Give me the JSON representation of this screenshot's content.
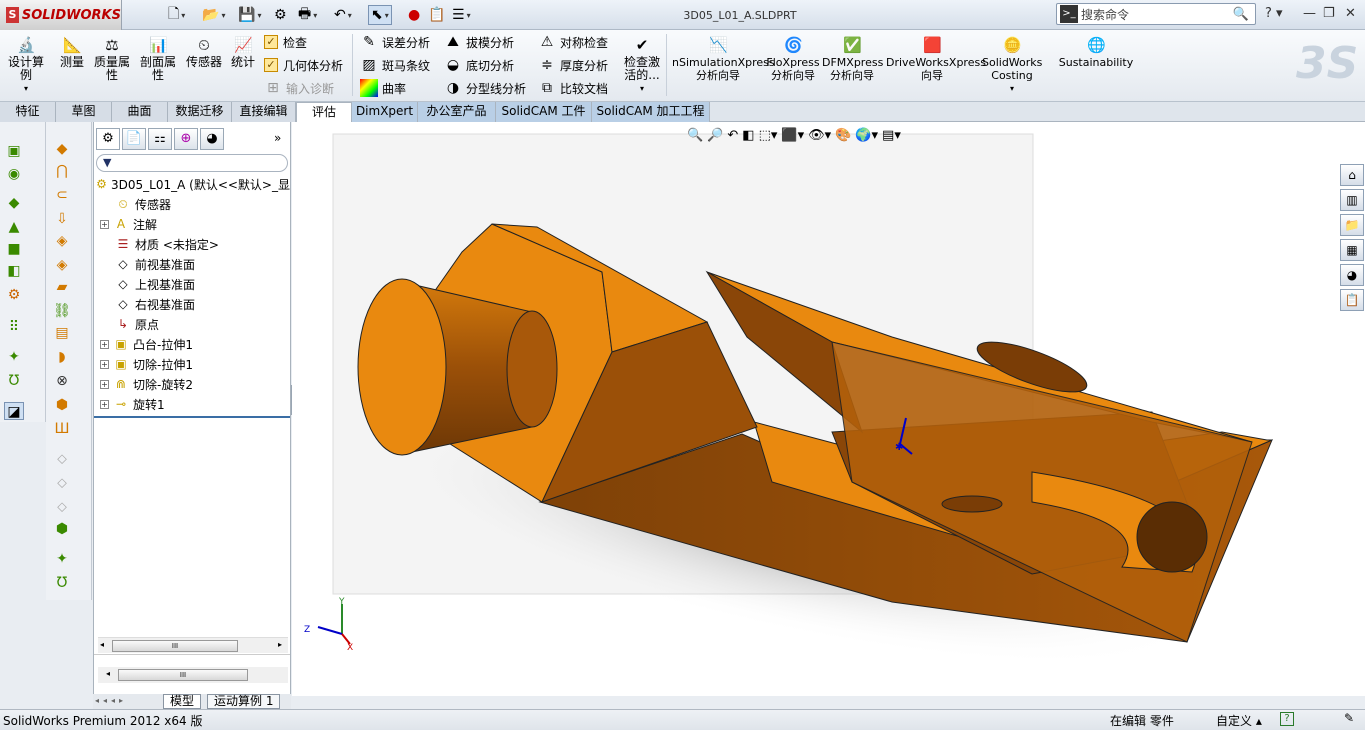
{
  "app": {
    "brand": "SOLIDWORKS",
    "doc_title": "3D05_L01_A.SLDPRT"
  },
  "search": {
    "placeholder": "搜索命令"
  },
  "ribbon": {
    "design_study": "设计算例",
    "measure": "测量",
    "mass_props": "质量属性",
    "section_props": "剖面属性",
    "sensor": "传感器",
    "stats": "统计",
    "check": "检查",
    "geometry_analysis": "几何体分析",
    "import_diag": "输入诊断",
    "deviation": "误差分析",
    "zebra": "斑马条纹",
    "curvature": "曲率",
    "draft": "拔模分析",
    "undercut": "底切分析",
    "parting_line": "分型线分析",
    "symmetry": "对称检查",
    "thickness": "厚度分析",
    "compare": "比较文档",
    "check_active": "检查激活的...",
    "simxpress": "nSimulationXpress\n分析向导",
    "floxpress": "FloXpress\n分析向导",
    "dfmxpress": "DFMXpress\n分析向导",
    "driveworks": "DriveWorksXpress\n向导",
    "costing": "SolidWorks\nCosting",
    "sustainability": "Sustainability"
  },
  "tabs": [
    "特征",
    "草图",
    "曲面",
    "数据迁移",
    "直接编辑",
    "评估",
    "DimXpert",
    "办公室产品",
    "SolidCAM 工件",
    "SolidCAM 加工工程"
  ],
  "active_tab": "评估",
  "tree": {
    "root": "3D05_L01_A  (默认<<默认>_显",
    "items": [
      "传感器",
      "注解",
      "材质 <未指定>",
      "前视基准面",
      "上视基准面",
      "右视基准面",
      "原点",
      "凸台-拉伸1",
      "切除-拉伸1",
      "切除-旋转2",
      "旋转1"
    ]
  },
  "bottom_tabs": [
    "模型",
    "运动算例 1"
  ],
  "status": {
    "left": "SolidWorks Premium 2012 x64 版",
    "editing": "在编辑 零件",
    "custom": "自定义"
  },
  "scrollbar_glyph": "III",
  "triad": {
    "x": "X",
    "y": "Y",
    "z": "Z"
  },
  "colors": {
    "part_light": "#e9890f",
    "part_dark": "#8a4608",
    "part_mid": "#c06c0c"
  }
}
